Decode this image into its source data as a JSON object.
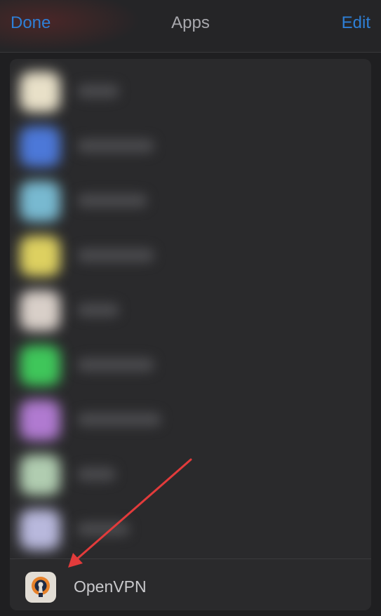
{
  "navbar": {
    "done_label": "Done",
    "title": "Apps",
    "edit_label": "Edit"
  },
  "colors": {
    "accent": "#2e7fd6",
    "annotation_arrow": "#e23b3b"
  },
  "apps": {
    "blurred_rows": [
      {
        "icon_color": "#e8e0c8"
      },
      {
        "icon_color": "#4c78d8"
      },
      {
        "icon_color": "#78b9d0"
      },
      {
        "icon_color": "#ddd060"
      },
      {
        "icon_color": "#d8cfc8"
      },
      {
        "icon_color": "#3fc65a"
      },
      {
        "icon_color": "#b07ad0"
      },
      {
        "icon_color": "#b0ccb0"
      },
      {
        "icon_color": "#b8b8dc"
      }
    ],
    "highlighted": {
      "label": "OpenVPN",
      "icon": "openvpn-logo-icon"
    }
  }
}
